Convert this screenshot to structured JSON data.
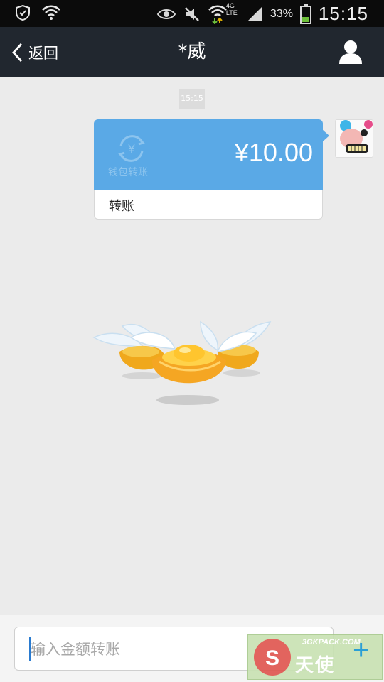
{
  "status_bar": {
    "battery_text": "33%",
    "network_text": "4G LTE",
    "time": "15:15",
    "icons": [
      "shield-icon",
      "wifi-icon",
      "eye-icon",
      "mute-icon",
      "wifi-signal-icon",
      "cell-signal-icon",
      "battery-icon"
    ]
  },
  "header": {
    "back_label": "返回",
    "title": "*威",
    "profile_icon": "person-icon"
  },
  "chat": {
    "timestamp": "15:15",
    "message": {
      "icon": "wallet-transfer-icon",
      "wallet_label": "钱包转账",
      "amount": "¥10.00",
      "caption": "转账"
    },
    "avatar": "avatar-image"
  },
  "input": {
    "placeholder": "输入金额转账",
    "plus_label": "+"
  },
  "watermark": {
    "line1": "3GKPACK.COM",
    "line2": "天使"
  },
  "colors": {
    "header_bg": "#21272f",
    "bubble_blue": "#5aa9e6",
    "background": "#ebebeb",
    "accent": "#2a9fd6"
  }
}
